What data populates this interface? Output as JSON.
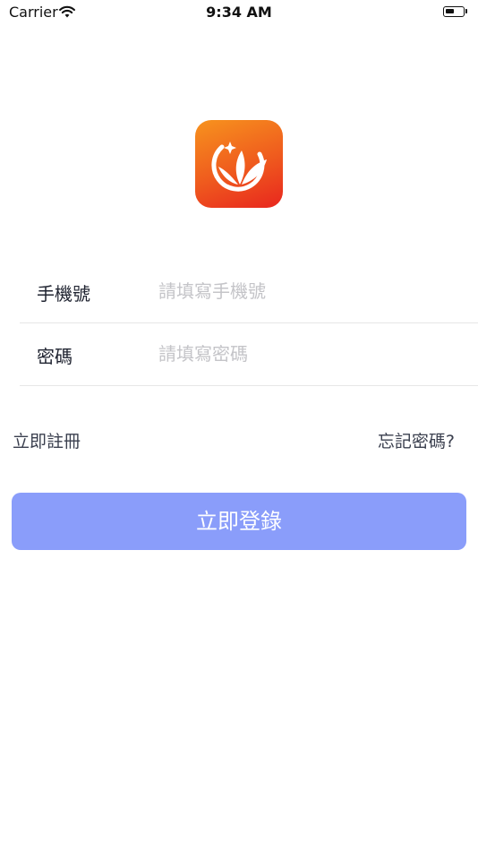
{
  "status_bar": {
    "carrier": "Carrier",
    "time": "9:34 AM",
    "wifi_icon": "wifi-icon",
    "battery_icon": "battery-icon"
  },
  "logo": {
    "icon": "app-logo-icon",
    "colors": [
      "#f7931e",
      "#e8261e"
    ]
  },
  "form": {
    "phone": {
      "label": "手機號",
      "placeholder": "請填寫手機號",
      "value": ""
    },
    "password": {
      "label": "密碼",
      "placeholder": "請填寫密碼",
      "value": ""
    }
  },
  "links": {
    "register": "立即註冊",
    "forgot_password": "忘記密碼?"
  },
  "login_button": {
    "label": "立即登錄",
    "color": "#8a9dfa"
  }
}
